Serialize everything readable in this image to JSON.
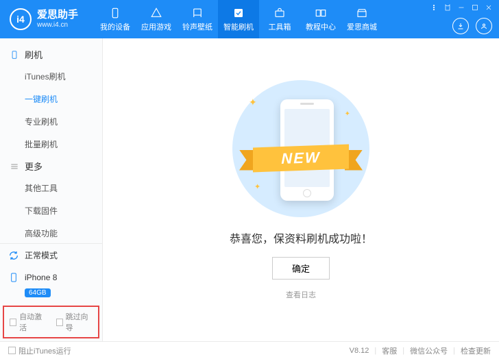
{
  "header": {
    "logo_badge": "i4",
    "logo_title": "爱思助手",
    "logo_url": "www.i4.cn",
    "nav": [
      {
        "label": "我的设备",
        "icon": "device"
      },
      {
        "label": "应用游戏",
        "icon": "apps"
      },
      {
        "label": "铃声壁纸",
        "icon": "music"
      },
      {
        "label": "智能刷机",
        "icon": "flash",
        "active": true
      },
      {
        "label": "工具箱",
        "icon": "toolbox"
      },
      {
        "label": "教程中心",
        "icon": "tutorial"
      },
      {
        "label": "爱思商城",
        "icon": "store"
      }
    ]
  },
  "sidebar": {
    "group_flash": "刷机",
    "flash_items": [
      "iTunes刷机",
      "一键刷机",
      "专业刷机",
      "批量刷机"
    ],
    "flash_active_index": 1,
    "group_more": "更多",
    "more_items": [
      "其他工具",
      "下载固件",
      "高级功能"
    ],
    "mode_label": "正常模式",
    "device_name": "iPhone 8",
    "device_storage": "64GB",
    "check_auto_activate": "自动激活",
    "check_skip_guide": "跳过向导"
  },
  "main": {
    "ribbon": "NEW",
    "message": "恭喜您，保资料刷机成功啦！",
    "ok": "确定",
    "view_log": "查看日志"
  },
  "footer": {
    "block_itunes": "阻止iTunes运行",
    "version": "V8.12",
    "support": "客服",
    "wechat": "微信公众号",
    "check_update": "检查更新"
  }
}
